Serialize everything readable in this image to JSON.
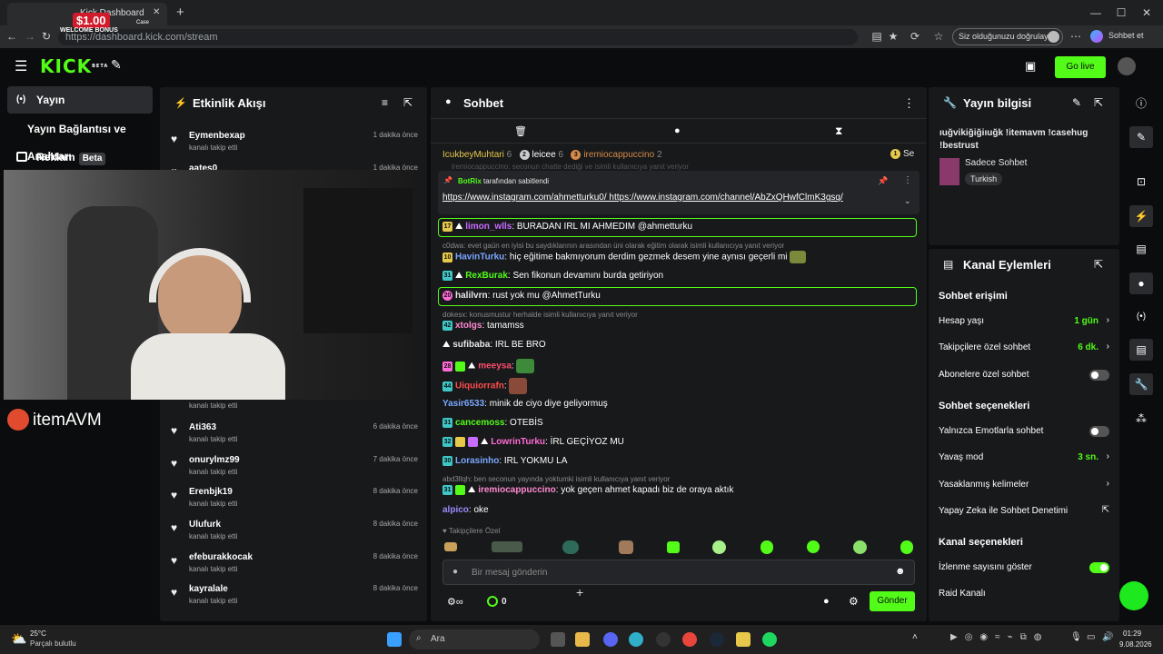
{
  "browser": {
    "tab_title": "Kick Dashboard",
    "url": "https://dashboard.kick.com/stream",
    "verify_label": "Siz olduğunuzu doğrulayın",
    "profile_label": "Sohbet et",
    "win_min": "—",
    "win_max": "☐",
    "win_close": "✕",
    "new_tab": "+"
  },
  "kick": {
    "logo": "KICK",
    "logo_sup": "BETA",
    "go_live": "Go live",
    "accent": "#53fc18"
  },
  "sidebar": {
    "items": [
      {
        "label": "Yayın",
        "icon": "broadcast-icon"
      },
      {
        "label": "Yayın Bağlantısı ve Anahtarı",
        "icon": ""
      },
      {
        "label": "Reklam",
        "icon": "ad-icon",
        "badge": "Beta"
      }
    ]
  },
  "overlay": {
    "bonus_amount": "$1.00",
    "bonus_label": "WELCOME BONUS",
    "brand": "itemAVM",
    "casebox": "Case"
  },
  "activity": {
    "title": "Etkinlik Akışı",
    "sub": "kanalı takip etti",
    "items": [
      {
        "name": "Eymenbexap",
        "time": "1 dakika önce"
      },
      {
        "name": "aates0",
        "time": "1 dakika önce"
      },
      {
        "name": "",
        "time": ""
      },
      {
        "name": "Ati363",
        "time": "6 dakika önce"
      },
      {
        "name": "onurylmz99",
        "time": "7 dakika önce"
      },
      {
        "name": "Erenbjk19",
        "time": "8 dakika önce"
      },
      {
        "name": "Ulufurk",
        "time": "8 dakika önce"
      },
      {
        "name": "efeburakkocak",
        "time": "8 dakika önce"
      },
      {
        "name": "kayralale",
        "time": "8 dakika önce"
      }
    ]
  },
  "chat": {
    "title": "Sohbet",
    "top_users": [
      {
        "name": "IcukbeyMuhtari",
        "n": "6"
      },
      {
        "name": "leicee",
        "n": "6",
        "rank": "2"
      },
      {
        "name": "iremiocappuccino",
        "n": "2",
        "rank": "3"
      }
    ],
    "see_more": "Se",
    "see_rank": "1",
    "faded_reply": "iremiocappuccino: seconun chatte dediği ve isimli kullanıcıya yanıt veriyor",
    "pinned_by": "BotRix",
    "pinned_suffix": "tarafından sabitlendi",
    "pinned_links": "https://www.instagram.com/ahmetturku0/ https://www.instagram.com/channel/AbZxQHwfClmK3gsq/",
    "messages": [
      {
        "badge": "17",
        "user": "limon_wlls",
        "color": "#c86bff",
        "text": "BURADAN IRL MI AHMEDIM @ahmetturku"
      },
      {
        "reply": "c0dwa: evet gaün en iyisi bu saydıklarının arasından üni olarak eğitim olarak isimli kullanıcıya yanıt veriyor"
      },
      {
        "badge": "10",
        "user": "HavinTurku",
        "color": "#7aa7ff",
        "text": "hiç eğitime bakmıyorum derdim gezmek desem yine aynısı geçerli mi"
      },
      {
        "badge": "31",
        "user": "RexBurak",
        "color": "#53fc18",
        "text": "Sen fikonun devamını burda getiriyon"
      },
      {
        "badge": "20",
        "user": "halilvrn",
        "color": "#e6e6e6",
        "text": "rust yok mu @AhmetTurku"
      },
      {
        "reply": "dokesx: konusmustur herhalde isimli kullanıcıya yanıt veriyor"
      },
      {
        "badge": "42",
        "user": "xtolgs",
        "color": "#ff8ad0",
        "text": "tamamss"
      },
      {
        "badge": "",
        "user": "sufibaba",
        "color": "#e6e6e6",
        "text": "IRL BE BRO"
      },
      {
        "badge": "28",
        "user": "meeysa",
        "color": "#ff4d6d",
        "text": ""
      },
      {
        "badge": "44",
        "user": "Uiquiorrafn",
        "color": "#ff4d4d",
        "text": ""
      },
      {
        "badge": "",
        "user": "Yasir6533",
        "color": "#7aa7ff",
        "text": "minik de ciyo diye geliyormuş"
      },
      {
        "badge": "31",
        "user": "cancemoss",
        "color": "#53fc18",
        "text": "OTEBİS"
      },
      {
        "badge": "32",
        "user": "LowrinTurku",
        "color": "#ff6bd6",
        "text": "İRL GEÇİYOZ MU"
      },
      {
        "badge": "30",
        "user": "Lorasinho",
        "color": "#7aa7ff",
        "text": "IRL YOKMU LA"
      },
      {
        "reply": "abd3llqh: ben seconun yayında yoktumki isimli kullanıcıya yanıt veriyor"
      },
      {
        "badge": "31",
        "user": "iremiocappuccino",
        "color": "#ff8ad0",
        "text": "yok geçen ahmet kapadı biz de oraya aktık"
      },
      {
        "badge": "",
        "user": "alpico",
        "color": "#9b8cff",
        "text": "oke"
      }
    ],
    "followers_only": "Takipçilere Özel",
    "input_placeholder": "Bir mesaj gönderin",
    "points": "0",
    "send": "Gönder"
  },
  "stream_info": {
    "title": "Yayın bilgisi",
    "stream_title": "ıuğvikiğiğiıuğk !itemavm !casehug !bestrust",
    "category": "Sadece Sohbet",
    "tag": "Turkish"
  },
  "channel_actions": {
    "title": "Kanal Eylemleri",
    "chat_access": "Sohbet erişimi",
    "account_age": "Hesap yaşı",
    "account_age_val": "1 gün",
    "followers_chat": "Takipçilere özel sohbet",
    "followers_chat_val": "6 dk.",
    "subs_chat": "Abonelere özel sohbet",
    "subs_chat_on": false,
    "chat_options": "Sohbet seçenekleri",
    "emote_only": "Yalnızca Emotlarla sohbet",
    "emote_only_on": false,
    "slow_mode": "Yavaş mod",
    "slow_mode_val": "3 sn.",
    "banned_words": "Yasaklanmış kelimeler",
    "ai_moderation": "Yapay Zeka ile Sohbet Denetimi",
    "channel_options": "Kanal seçenekleri",
    "show_viewers": "İzlenme sayısını göster",
    "show_viewers_on": true,
    "raid": "Raid Kanalı"
  },
  "taskbar": {
    "weather_temp": "25°C",
    "weather_desc": "Parçalı bulutlu",
    "search": "Ara",
    "time": "01:29",
    "date": "9.08.2026"
  }
}
